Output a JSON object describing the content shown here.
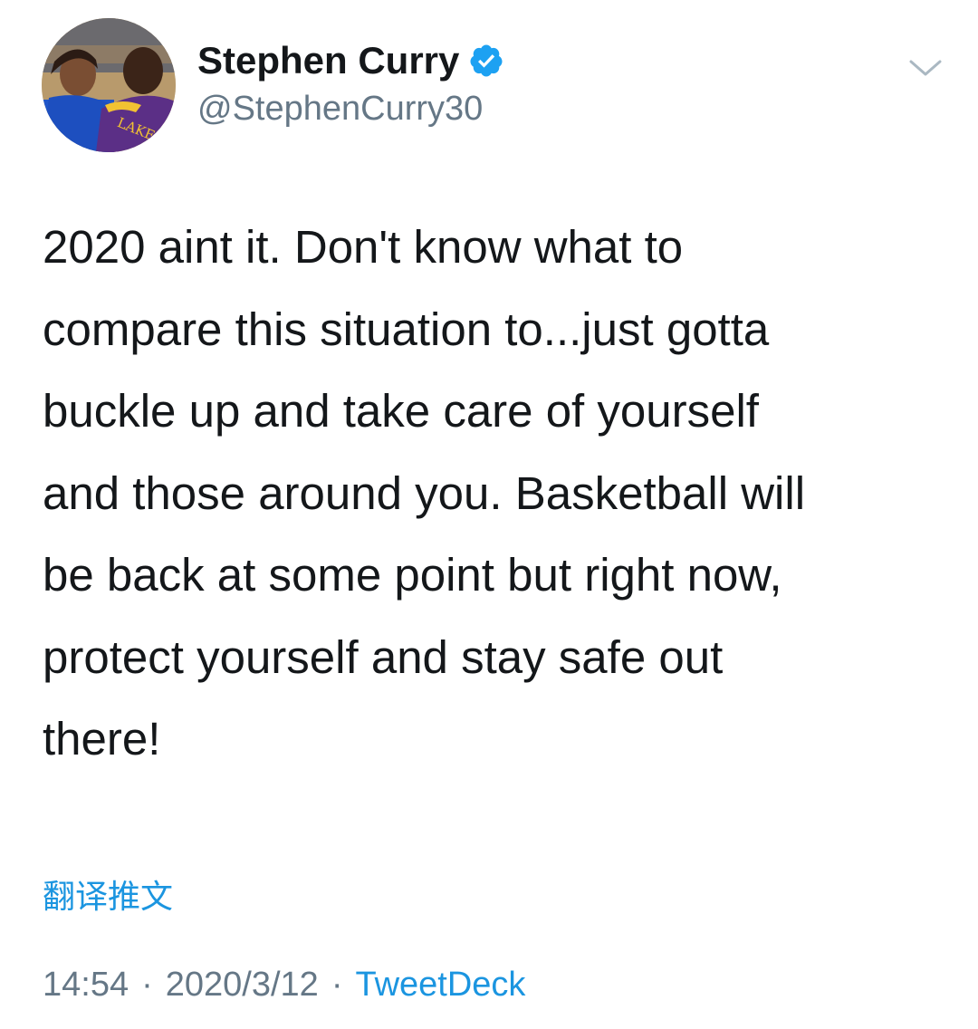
{
  "tweet": {
    "author": {
      "display_name": "Stephen Curry",
      "handle": "@StephenCurry30",
      "verified": true,
      "avatar_icon": "profile-photo",
      "avatar_text": "LAKERS"
    },
    "text": "2020 aint it. Don't know what to\ncompare this situation to...just gotta\nbuckle up and take care of yourself\nand those around you. Basketball will\nbe back at some point but right now,\nprotect yourself and stay safe out\nthere!",
    "translate_label": "翻译推文",
    "time": "14:54",
    "date": "2020/3/12",
    "separator": "·",
    "source": "TweetDeck",
    "menu_icon": "chevron-down-icon",
    "colors": {
      "text": "#14171a",
      "secondary": "#657786",
      "link": "#1b95e0",
      "verified_badge": "#1da1f2"
    }
  }
}
